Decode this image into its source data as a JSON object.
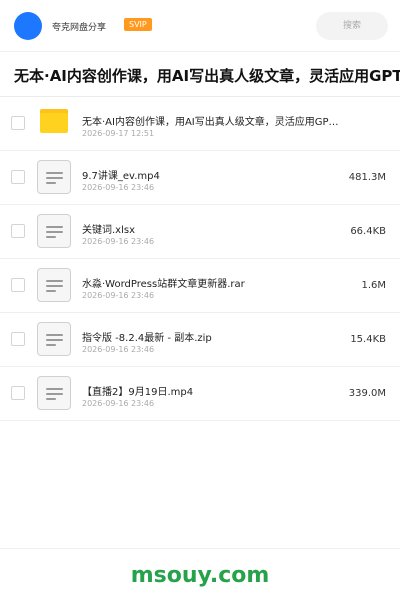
{
  "header": {
    "username": "夸克网盘分享",
    "badge": "SVIP",
    "search_placeholder": "搜索"
  },
  "page_title": "无本·AI内容创作课，用AI写出真人级文章，灵活应用GPT，",
  "files": [
    {
      "type": "folder",
      "name": "无本·AI内容创作课，用AI写出真人级文章，灵活应用GPT，",
      "date": "2026-09-17 12:51",
      "size": ""
    },
    {
      "type": "file",
      "name": "9.7讲课_ev.mp4",
      "date": "2026-09-16 23:46",
      "size": "481.3M"
    },
    {
      "type": "file",
      "name": "关键词.xlsx",
      "date": "2026-09-16 23:46",
      "size": "66.4KB"
    },
    {
      "type": "file",
      "name": "水淼·WordPress站群文章更新器.rar",
      "date": "2026-09-16 23:46",
      "size": "1.6M"
    },
    {
      "type": "file",
      "name": "指令版 -8.2.4最新 - 副本.zip",
      "date": "2026-09-16 23:46",
      "size": "15.4KB"
    },
    {
      "type": "file",
      "name": "【直播2】9月19日.mp4",
      "date": "2026-09-16 23:46",
      "size": "339.0M"
    }
  ],
  "watermark": "msouy.com"
}
